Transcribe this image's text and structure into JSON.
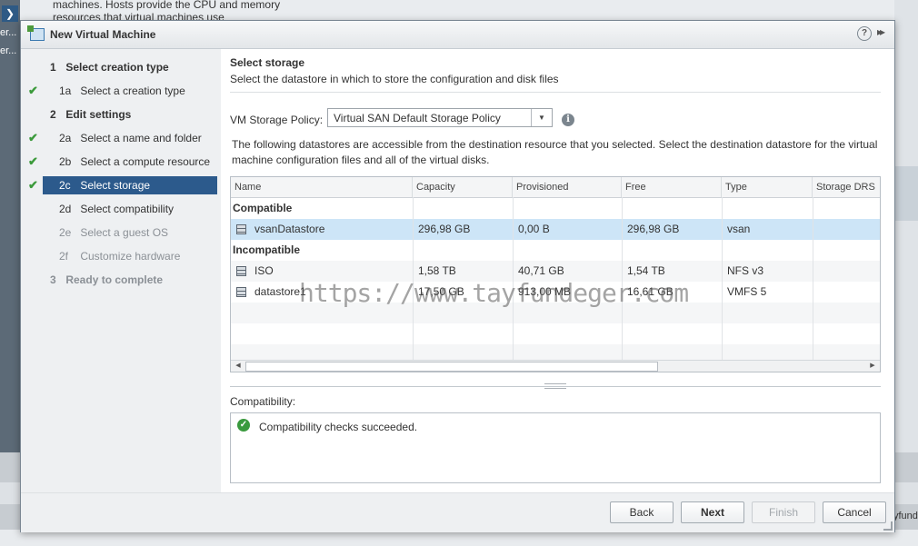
{
  "background": {
    "text": "machines. Hosts provide the CPU and memory resources that virtual machines use",
    "left_items": [
      "er...",
      "er..."
    ],
    "fund_text": "yfund"
  },
  "dialog": {
    "title": "New Virtual Machine",
    "help_icon": "?",
    "expand_icon": "▸▸"
  },
  "nav": {
    "items": [
      {
        "num": "1",
        "label": "Select creation type",
        "kind": "section",
        "checked": false
      },
      {
        "num": "1a",
        "label": "Select a creation type",
        "kind": "sub",
        "checked": true
      },
      {
        "num": "2",
        "label": "Edit settings",
        "kind": "section",
        "checked": false
      },
      {
        "num": "2a",
        "label": "Select a name and folder",
        "kind": "sub",
        "checked": true
      },
      {
        "num": "2b",
        "label": "Select a compute resource",
        "kind": "sub",
        "checked": true
      },
      {
        "num": "2c",
        "label": "Select storage",
        "kind": "sub",
        "checked": true,
        "active": true
      },
      {
        "num": "2d",
        "label": "Select compatibility",
        "kind": "sub",
        "checked": false
      },
      {
        "num": "2e",
        "label": "Select a guest OS",
        "kind": "sub",
        "checked": false,
        "disabled": true
      },
      {
        "num": "2f",
        "label": "Customize hardware",
        "kind": "sub",
        "checked": false,
        "disabled": true
      },
      {
        "num": "3",
        "label": "Ready to complete",
        "kind": "section",
        "checked": false,
        "disabled": true
      }
    ]
  },
  "content": {
    "title": "Select storage",
    "description": "Select the datastore in which to store the configuration and disk files",
    "policy_label": "VM Storage Policy:",
    "policy_value": "Virtual SAN Default Storage Policy",
    "paragraph": "The following datastores are accessible from the destination resource that you selected. Select the destination datastore for the virtual machine configuration files and all of the virtual disks.",
    "table": {
      "columns": [
        "Name",
        "Capacity",
        "Provisioned",
        "Free",
        "Type",
        "Storage DRS"
      ],
      "groups": [
        {
          "label": "Compatible",
          "rows": [
            {
              "name": "vsanDatastore",
              "capacity": "296,98 GB",
              "provisioned": "0,00 B",
              "free": "296,98 GB",
              "type": "vsan",
              "drs": "",
              "selected": true
            }
          ]
        },
        {
          "label": "Incompatible",
          "rows": [
            {
              "name": "ISO",
              "capacity": "1,58 TB",
              "provisioned": "40,71 GB",
              "free": "1,54 TB",
              "type": "NFS v3",
              "drs": ""
            },
            {
              "name": "datastore1",
              "capacity": "17,50 GB",
              "provisioned": "913,00 MB",
              "free": "16,61 GB",
              "type": "VMFS 5",
              "drs": ""
            }
          ]
        }
      ]
    },
    "compat_label": "Compatibility:",
    "compat_message": "Compatibility checks succeeded.",
    "watermark": "https://www.tayfundeger.com"
  },
  "footer": {
    "back": "Back",
    "next": "Next",
    "finish": "Finish",
    "cancel": "Cancel"
  },
  "colors": {
    "active_nav": "#2c5a8c",
    "selected_row": "#cde5f7",
    "check": "#3b9a3b"
  }
}
